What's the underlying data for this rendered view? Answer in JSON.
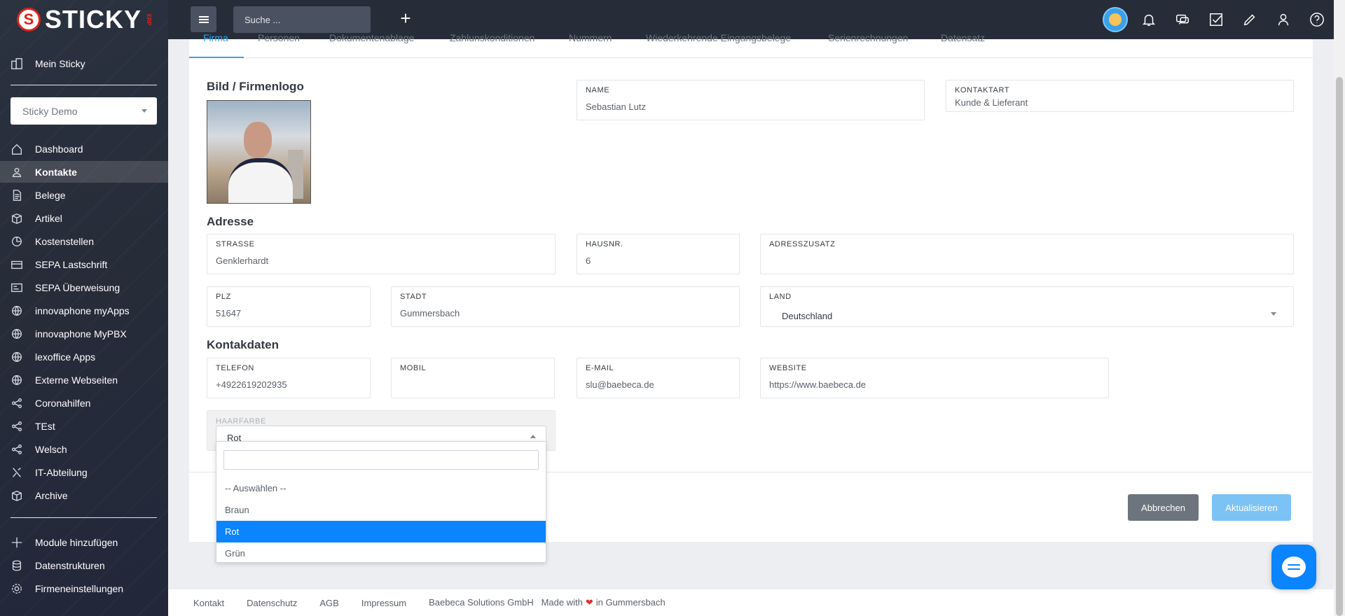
{
  "brand": {
    "logo_letter": "S",
    "name": "STICKY",
    "sub": "ERP"
  },
  "sidebar": {
    "top_item": {
      "label": "Mein Sticky",
      "icon": "building-icon"
    },
    "tenant_select": "Sticky Demo",
    "items": [
      {
        "label": "Dashboard",
        "icon": "home-icon"
      },
      {
        "label": "Kontakte",
        "icon": "contacts-icon",
        "active": true
      },
      {
        "label": "Belege",
        "icon": "document-icon"
      },
      {
        "label": "Artikel",
        "icon": "box-icon"
      },
      {
        "label": "Kostenstellen",
        "icon": "pie-icon"
      },
      {
        "label": "SEPA Lastschrift",
        "icon": "card-icon"
      },
      {
        "label": "SEPA Überweisung",
        "icon": "transfer-icon"
      },
      {
        "label": "innovaphone myApps",
        "icon": "globe-icon"
      },
      {
        "label": "innovaphone MyPBX",
        "icon": "globe-icon"
      },
      {
        "label": "lexoffice Apps",
        "icon": "globe-icon"
      },
      {
        "label": "Externe Webseiten",
        "icon": "globe-icon"
      },
      {
        "label": "Coronahilfen",
        "icon": "share-icon"
      },
      {
        "label": "TEst",
        "icon": "share-icon"
      },
      {
        "label": "Welsch",
        "icon": "share-icon"
      },
      {
        "label": "IT-Abteilung",
        "icon": "sitemap-icon"
      },
      {
        "label": "Archive",
        "icon": "box-icon"
      }
    ],
    "bottom_items": [
      {
        "label": "Module hinzufügen",
        "icon": "plus-icon"
      },
      {
        "label": "Datenstrukturen",
        "icon": "database-icon"
      },
      {
        "label": "Firmeneinstellungen",
        "icon": "gear-icon"
      }
    ]
  },
  "topbar": {
    "search_placeholder": "Suche ...",
    "icons": [
      "avatar-icon",
      "bell-icon",
      "chat-icon",
      "checkbox-icon",
      "pencil-icon",
      "user-icon",
      "help-icon"
    ]
  },
  "tabs": [
    "Firma",
    "Personen",
    "Dokumentenablage",
    "Zahlunskonditionen",
    "Nummern",
    "Wiederkehrende Eingangsbelege",
    "Serienrechnungen",
    "Datensatz"
  ],
  "form": {
    "photo_title": "Bild / Firmenlogo",
    "name": {
      "label": "NAME",
      "value": "Sebastian Lutz"
    },
    "kontaktart": {
      "label": "KONTAKTART",
      "value": "Kunde & Lieferant"
    },
    "address_title": "Adresse",
    "strasse": {
      "label": "STRASSE",
      "value": "Genklerhardt"
    },
    "hausnr": {
      "label": "HAUSNR.",
      "value": "6"
    },
    "adresszusatz": {
      "label": "ADRESSZUSATZ",
      "value": ""
    },
    "plz": {
      "label": "PLZ",
      "value": "51647"
    },
    "stadt": {
      "label": "STADT",
      "value": "Gummersbach"
    },
    "land": {
      "label": "LAND",
      "value": "Deutschland"
    },
    "contact_title": "Kontakdaten",
    "telefon": {
      "label": "TELEFON",
      "value": "+4922619202935"
    },
    "mobil": {
      "label": "MOBIL",
      "value": ""
    },
    "email": {
      "label": "E-MAIL",
      "value": "slu@baebeca.de"
    },
    "website": {
      "label": "WEBSITE",
      "value": "https://www.baebeca.de"
    },
    "haarfarbe": {
      "label": "HAARFARBE",
      "value": "Rot"
    }
  },
  "dropdown": {
    "options": [
      "-- Auswählen --",
      "Braun",
      "Rot",
      "Grün"
    ],
    "selected": "Rot"
  },
  "buttons": {
    "cancel": "Abbrechen",
    "update": "Aktualisieren"
  },
  "footer": {
    "links": [
      "Kontakt",
      "Datenschutz",
      "AGB",
      "Impressum",
      "Baebeca Solutions GmbH"
    ],
    "made_with": "Made with",
    "made_in": "in Gummersbach"
  },
  "colors": {
    "accent": "#3aa1e8",
    "selected": "#0a84ff",
    "sidebar": "#262c38"
  }
}
